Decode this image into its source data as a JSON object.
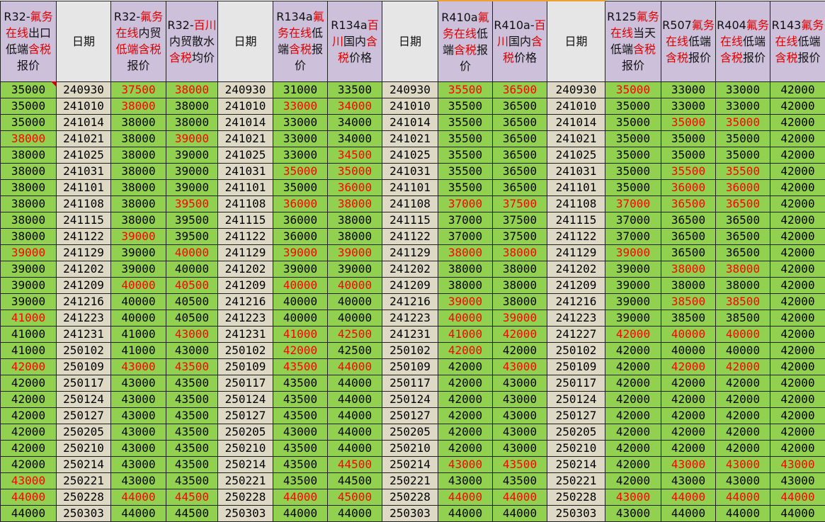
{
  "colors": {
    "header_purple": "#ccc0da",
    "header_grey": "#e6e6e6",
    "cell_green": "#92d050",
    "cell_beige": "#ddd9c4",
    "text_red": "#ff0000",
    "header_red": "#e00000"
  },
  "columns": [
    {
      "key": "r32_export",
      "bg": "purple",
      "header": [
        {
          "t": "R32-"
        },
        {
          "t": "氟务在线",
          "red": true
        },
        {
          "t": "出口低端"
        },
        {
          "t": "含税",
          "red": true
        },
        {
          "t": "报价"
        }
      ]
    },
    {
      "key": "date1",
      "bg": "grey",
      "header": [
        {
          "t": "日期"
        }
      ]
    },
    {
      "key": "r32_domestic",
      "bg": "purple",
      "header": [
        {
          "t": "R32-"
        },
        {
          "t": "氟务在线",
          "red": true
        },
        {
          "t": "内贸"
        },
        {
          "t": "低端含税",
          "red": true
        },
        {
          "t": "报价"
        }
      ]
    },
    {
      "key": "r32_baichuan",
      "bg": "purple",
      "header": [
        {
          "t": "R32-"
        },
        {
          "t": "百川",
          "red": true
        },
        {
          "t": "内贸散水"
        },
        {
          "t": "含税",
          "red": true
        },
        {
          "t": "均价"
        }
      ]
    },
    {
      "key": "date2",
      "bg": "grey",
      "header": [
        {
          "t": "日期"
        }
      ]
    },
    {
      "key": "r134a_online",
      "bg": "purple",
      "header": [
        {
          "t": "R134a"
        },
        {
          "t": "氟务在线",
          "red": true
        },
        {
          "t": "低端"
        },
        {
          "t": "含税",
          "red": true
        },
        {
          "t": "报价"
        }
      ]
    },
    {
      "key": "r134a_baichuan",
      "bg": "purple",
      "header": [
        {
          "t": "R134a"
        },
        {
          "t": "百川",
          "red": true
        },
        {
          "t": "国内"
        },
        {
          "t": "含税",
          "red": true
        },
        {
          "t": "价格"
        }
      ]
    },
    {
      "key": "date3",
      "bg": "grey",
      "header": [
        {
          "t": "日期"
        }
      ]
    },
    {
      "key": "r410a_online",
      "bg": "purple",
      "orange": true,
      "header": [
        {
          "t": "R410a"
        },
        {
          "t": "氟务在线",
          "red": true
        },
        {
          "t": "低端"
        },
        {
          "t": "含税",
          "red": true
        },
        {
          "t": "报价"
        }
      ]
    },
    {
      "key": "r410a_baichuan",
      "bg": "purple",
      "orange": true,
      "header": [
        {
          "t": "R410a-"
        },
        {
          "t": "百川",
          "red": true
        },
        {
          "t": "国内"
        },
        {
          "t": "含税",
          "red": true
        },
        {
          "t": "价格"
        }
      ]
    },
    {
      "key": "date4",
      "bg": "grey",
      "orange": true,
      "header": [
        {
          "t": "日期"
        }
      ]
    },
    {
      "key": "r125",
      "bg": "purple",
      "header": [
        {
          "t": "R125"
        },
        {
          "t": "氟务在线",
          "red": true
        },
        {
          "t": "当天低端"
        },
        {
          "t": "含税",
          "red": true
        },
        {
          "t": "报价"
        }
      ]
    },
    {
      "key": "r507",
      "bg": "purple",
      "header": [
        {
          "t": "R507"
        },
        {
          "t": "氟务在线",
          "red": true
        },
        {
          "t": "低端"
        },
        {
          "t": "含税",
          "red": true
        },
        {
          "t": "报价"
        }
      ]
    },
    {
      "key": "r404",
      "bg": "purple",
      "header": [
        {
          "t": "R404"
        },
        {
          "t": "氟务在线",
          "red": true
        },
        {
          "t": "低端"
        },
        {
          "t": "含税",
          "red": true
        },
        {
          "t": "报价"
        }
      ]
    },
    {
      "key": "r143",
      "bg": "purple",
      "header": [
        {
          "t": "R143"
        },
        {
          "t": "氟务在线",
          "red": true
        },
        {
          "t": "低端"
        },
        {
          "t": "含税",
          "red": true
        },
        {
          "t": "报价"
        }
      ]
    }
  ],
  "rows": [
    [
      "35000",
      "240930",
      "37500*",
      "38000*",
      "240930",
      "31000",
      "33500",
      "240930",
      "35500*",
      "36500*",
      "240930",
      "35000*",
      "33000",
      "33000",
      "42000"
    ],
    [
      "35000",
      "241010",
      "38000*",
      "38000",
      "241010",
      "33000*",
      "34000*",
      "241010",
      "35500",
      "36500",
      "241010",
      "35000",
      "33000",
      "33000",
      "42000"
    ],
    [
      "35000",
      "241014",
      "38000",
      "38000",
      "241014",
      "33000",
      "34000",
      "241014",
      "35500",
      "36500",
      "241014",
      "35000",
      "35000*",
      "35000*",
      "42000"
    ],
    [
      "38000*",
      "241021",
      "38000",
      "39000*",
      "241021",
      "33000",
      "34000",
      "241021",
      "35500",
      "36500",
      "241021",
      "35000",
      "35000",
      "35000",
      "42000"
    ],
    [
      "38000",
      "241025",
      "38000",
      "39000",
      "241025",
      "33000",
      "34500*",
      "241025",
      "35500",
      "36500",
      "241025",
      "35000",
      "35000",
      "35000",
      "42000"
    ],
    [
      "38000",
      "241031",
      "38000",
      "39000",
      "241031",
      "35000*",
      "35000*",
      "241031",
      "35500",
      "36500",
      "241031",
      "35000",
      "35500*",
      "35500*",
      "42000"
    ],
    [
      "38000",
      "241101",
      "38000",
      "39000",
      "241101",
      "35000",
      "36000*",
      "241101",
      "35500",
      "36500",
      "241101",
      "35000",
      "36000*",
      "36000*",
      "42000"
    ],
    [
      "38000",
      "241108",
      "38000",
      "39500*",
      "241108",
      "36000*",
      "38000*",
      "241108",
      "37000*",
      "37500*",
      "241108",
      "37000*",
      "36500*",
      "36500*",
      "42000"
    ],
    [
      "38000",
      "241115",
      "38000",
      "39500",
      "241115",
      "36000",
      "38000",
      "241115",
      "37000",
      "37500",
      "241115",
      "37000",
      "36500",
      "36500",
      "42000"
    ],
    [
      "38000",
      "241122",
      "39000*",
      "39500",
      "241122",
      "36000",
      "38000",
      "241122",
      "37000",
      "37500",
      "241122",
      "37000",
      "36500",
      "36500",
      "42000"
    ],
    [
      "39000*",
      "241129",
      "39000",
      "40000*",
      "241129",
      "39000*",
      "39000*",
      "241129",
      "38000*",
      "38000*",
      "241129",
      "39000*",
      "36500",
      "36500",
      "42000"
    ],
    [
      "39000",
      "241202",
      "39000",
      "40000",
      "241202",
      "39000",
      "39000",
      "241202",
      "38000",
      "38000",
      "241202",
      "39000",
      "38000*",
      "38000*",
      "42000"
    ],
    [
      "39000",
      "241209",
      "40000*",
      "40500*",
      "241209",
      "40000*",
      "40000*",
      "241209",
      "38000",
      "38000",
      "241209",
      "39000",
      "38000",
      "38000",
      "42000"
    ],
    [
      "39000",
      "241216",
      "40000",
      "40500",
      "241216",
      "40000",
      "40000",
      "241216",
      "39000*",
      "38000",
      "241216",
      "39000",
      "38500*",
      "38500*",
      "42000"
    ],
    [
      "41000*",
      "241223",
      "40000",
      "40500",
      "241223",
      "40000",
      "40000",
      "241223",
      "40000*",
      "39000*",
      "241223",
      "39000",
      "38500",
      "38500",
      "42000"
    ],
    [
      "41000",
      "241231",
      "41000",
      "43000*",
      "241231",
      "41000*",
      "42500*",
      "241231",
      "41000*",
      "42000*",
      "241227",
      "42000*",
      "40000*",
      "40000*",
      "42000"
    ],
    [
      "41000",
      "250102",
      "41000",
      "43000",
      "250102",
      "42000*",
      "42500",
      "250102",
      "42000*",
      "42000",
      "250102",
      "42000",
      "40000",
      "40000",
      "42000"
    ],
    [
      "42000*",
      "250109",
      "43000*",
      "43500*",
      "250109",
      "43500*",
      "44000*",
      "250109",
      "42000",
      "43000*",
      "250109",
      "42000",
      "42000*",
      "42000*",
      "42000"
    ],
    [
      "42000",
      "250117",
      "43000",
      "43500",
      "250117",
      "43500",
      "44000",
      "250117",
      "42000",
      "43000",
      "250117",
      "42000",
      "42000",
      "42000",
      "42000"
    ],
    [
      "42000",
      "250124",
      "43000",
      "43500",
      "250124",
      "43500",
      "44000",
      "250124",
      "42000",
      "43000",
      "250124",
      "42000",
      "42000",
      "42000",
      "42000"
    ],
    [
      "42000",
      "250127",
      "43000",
      "43500",
      "250127",
      "43500",
      "44000",
      "250127",
      "42000",
      "43000",
      "250127",
      "42000",
      "42000",
      "42000",
      "42000"
    ],
    [
      "42000",
      "250205",
      "43000",
      "43500",
      "250205",
      "43000",
      "44000",
      "250205",
      "42000",
      "43000",
      "250205",
      "42000",
      "42000",
      "42000",
      "42000"
    ],
    [
      "42000",
      "250210",
      "43000",
      "43500",
      "250210",
      "43500",
      "44000",
      "250210",
      "42000",
      "43000",
      "250210",
      "42000",
      "42000",
      "42000",
      "42000"
    ],
    [
      "42000",
      "250214",
      "43000",
      "43500",
      "250214",
      "43500",
      "44500*",
      "250214",
      "43000*",
      "43500*",
      "250214",
      "42000",
      "43000*",
      "43000*",
      "43000*"
    ],
    [
      "43000*",
      "250221",
      "43000",
      "43500",
      "250221",
      "43500",
      "44500",
      "250221",
      "43000",
      "43500",
      "250221",
      "42000",
      "43000",
      "43000",
      "43000"
    ],
    [
      "44000*",
      "250228",
      "44000*",
      "44500*",
      "250228",
      "44000*",
      "45000*",
      "250228",
      "44000*",
      "44000*",
      "250228",
      "43000*",
      "44000*",
      "44000*",
      "44000*"
    ],
    [
      "44000",
      "250303",
      "44000",
      "44500",
      "250303",
      "44000",
      "44000",
      "250303",
      "44000",
      "44000",
      "250303",
      "43000",
      "44000",
      "44000",
      "44000"
    ]
  ]
}
